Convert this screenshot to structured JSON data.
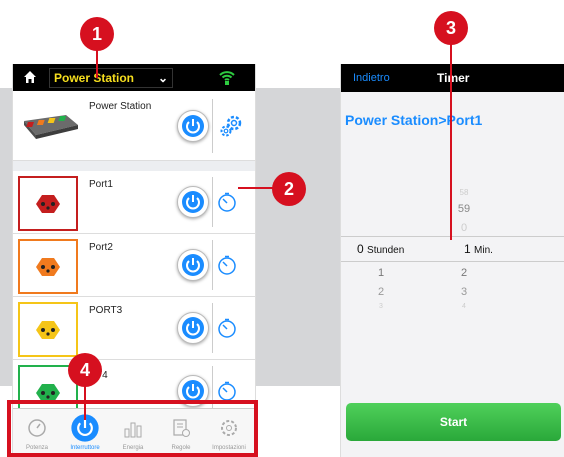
{
  "left_app": {
    "title": "Power Station",
    "power_station": {
      "label": "Power Station"
    },
    "ports": [
      {
        "label": "Port1",
        "color": "#c41e1e"
      },
      {
        "label": "Port2",
        "color": "#f07a1e"
      },
      {
        "label": "PORT3",
        "color": "#f5c518"
      },
      {
        "label": "RT4",
        "color": "#22b14c"
      }
    ],
    "tabs": [
      {
        "label": "Potenza",
        "icon": "gauge-icon"
      },
      {
        "label": "Interruttore",
        "icon": "power-tab-icon"
      },
      {
        "label": "Energia",
        "icon": "bar-chart-icon"
      },
      {
        "label": "Regole",
        "icon": "rules-icon"
      },
      {
        "label": "Impostazioni",
        "icon": "settings-icon"
      }
    ]
  },
  "right_app": {
    "back_label": "Indietro",
    "title": "Timer",
    "breadcrumb": "Power Station>Port1",
    "picker": {
      "above": [
        "58",
        "59",
        "0"
      ],
      "selected_hours": "0",
      "hours_unit": "Stunden",
      "selected_minutes": "1",
      "minutes_unit": "Min.",
      "hours_below": [
        "1",
        "2",
        "3"
      ],
      "minutes_below": [
        "2",
        "3",
        "4"
      ]
    },
    "start_label": "Start"
  },
  "markers": [
    "1",
    "2",
    "3",
    "4"
  ],
  "colors": {
    "accent_blue": "#1a8cff",
    "annotation_red": "#d6101f",
    "title_yellow": "#f7df1e"
  }
}
